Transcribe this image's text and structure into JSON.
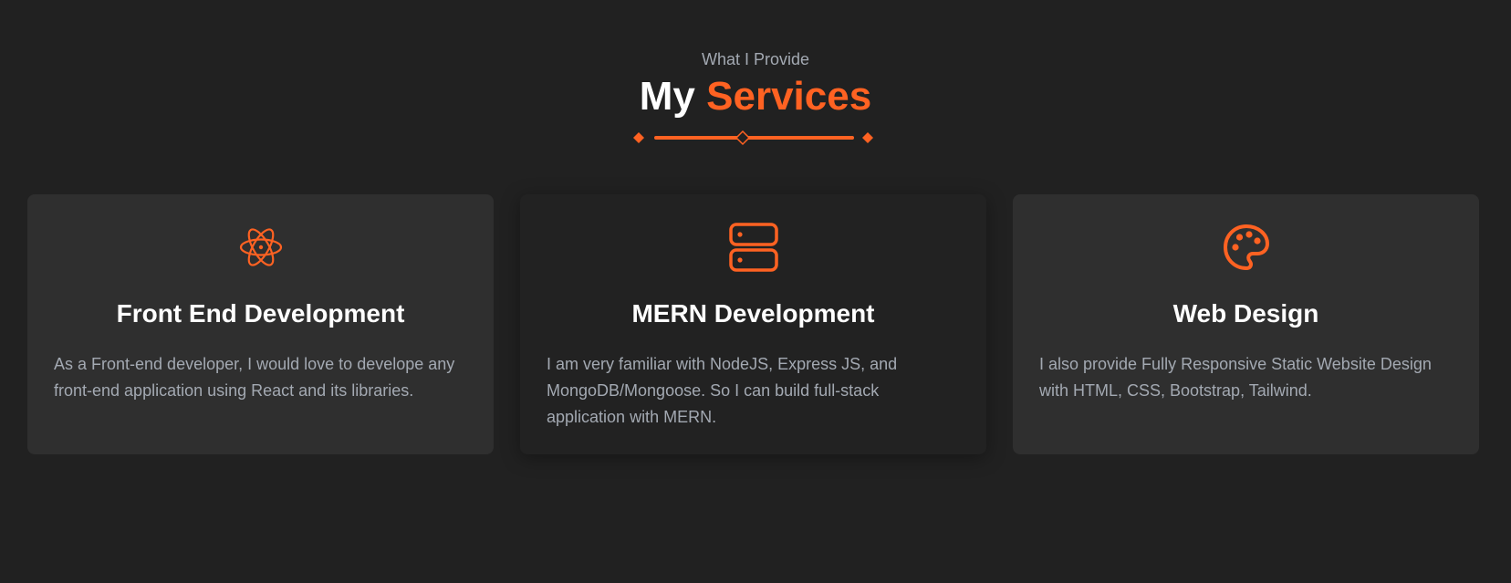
{
  "header": {
    "subtitle": "What I Provide",
    "title_plain": "My",
    "title_accent": "Services"
  },
  "colors": {
    "background": "#212121",
    "accent": "#ff6222",
    "card": "#2f2f2f",
    "card_highlight": "#222222",
    "heading": "#ffffff",
    "body_text": "#a3a9b2"
  },
  "services": [
    {
      "icon": "atom-icon",
      "title": "Front End Development",
      "description": "As a Front-end developer, I would love to develope any front-end application using React and its libraries."
    },
    {
      "icon": "server-icon",
      "title": "MERN Development",
      "description": "I am very familiar with NodeJS, Express JS, and MongoDB/Mongoose. So I can build full-stack application with MERN."
    },
    {
      "icon": "palette-icon",
      "title": "Web Design",
      "description": "I also provide Fully Responsive Static Website Design with HTML, CSS, Bootstrap, Tailwind."
    }
  ]
}
